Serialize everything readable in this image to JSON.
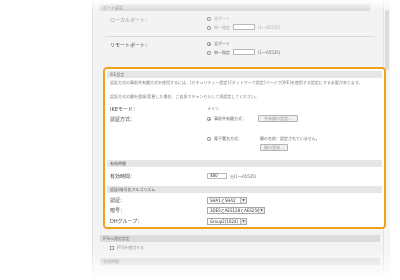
{
  "colors": {
    "highlight": "#f0a21c",
    "section_header_bg": "#dcdcdc"
  },
  "top_section": {
    "header": "ポート設定",
    "local_port": {
      "label": "ローカルポート：",
      "options": [
        "全ポート",
        "単一指定"
      ],
      "range": "(1〜65535)"
    },
    "remote_port": {
      "label": "リモートポート：",
      "options": [
        "全ポート",
        "単一指定"
      ],
      "range": "(1〜65535)"
    }
  },
  "ike": {
    "header": "IKE設定",
    "description_1": "認証方式の事前共有鍵方式を使用するには、[セキュリティー設定]-[ネットワーク設定]ページで[IKE]を使用する設定にする必要があります。",
    "description_2": "認証方式の鍵を登録/変更した場合、ご自身でキャンセルして再設定してください。",
    "ike_mode": {
      "label": "IKEモード：",
      "value": "メイン"
    },
    "auth": {
      "label": "認証方式：",
      "option1": "事前共有鍵方式：",
      "option1_button": "共有鍵の設定...",
      "option2": "電子署名方式：",
      "option2_status": "鍵の名前：設定されていません。",
      "option2_button": "鍵の登録..."
    }
  },
  "validity": {
    "header": "有効時間",
    "label": "有効時間：",
    "value": "480",
    "range": "分(1〜65535)"
  },
  "algorithm": {
    "header": "認証/暗号化アルゴリズム",
    "auth_label": "認証：",
    "auth_value": "SHA1とSHA2",
    "encrypt_label": "暗号：",
    "encrypt_value": "3DESとAES128とAES256",
    "dh_label": "DHグループ：",
    "dh_value": "Group2(1024)"
  },
  "ipsec": {
    "header": "IPSec通信設定",
    "pfs_label": "PFSを使用する"
  },
  "validity2": {
    "header": "有効時間"
  }
}
